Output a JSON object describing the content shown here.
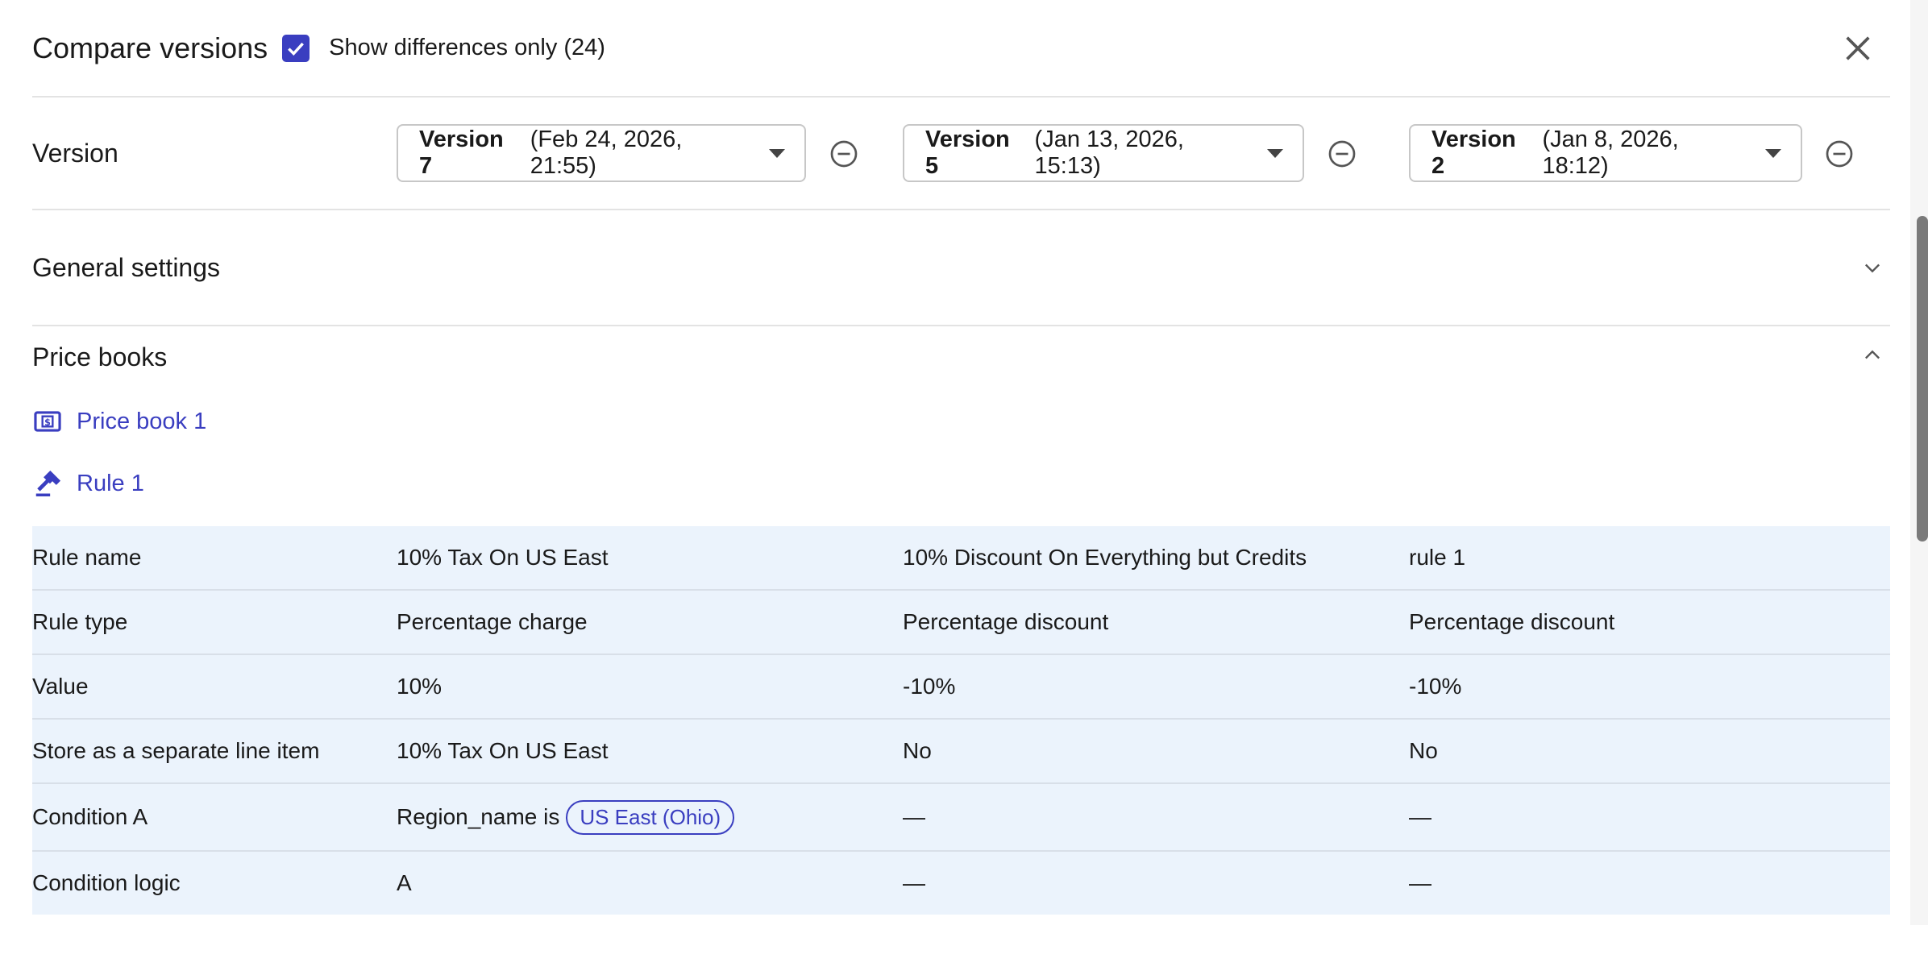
{
  "header": {
    "title": "Compare versions",
    "show_diff_label": "Show differences only (24)",
    "show_diff_checked": true
  },
  "version_row": {
    "label": "Version",
    "versions": [
      {
        "name": "Version 7",
        "date": "(Feb 24, 2026, 21:55)"
      },
      {
        "name": "Version 5",
        "date": "(Jan 13, 2026, 15:13)"
      },
      {
        "name": "Version 2",
        "date": "(Jan 8, 2026, 18:12)"
      }
    ]
  },
  "sections": {
    "general": "General settings",
    "price_books": "Price books"
  },
  "links": {
    "price_book": "Price book 1",
    "rule": "Rule 1"
  },
  "rows": [
    {
      "label": "Rule name",
      "v1": "10% Tax On US East",
      "v2": "10% Discount On Everything but Credits",
      "v3": "rule 1"
    },
    {
      "label": "Rule type",
      "v1": "Percentage charge",
      "v2": "Percentage discount",
      "v3": "Percentage discount"
    },
    {
      "label": "Value",
      "v1": "10%",
      "v2": "-10%",
      "v3": "-10%"
    },
    {
      "label": "Store as a separate line item",
      "v1": "10% Tax On US East",
      "v2": "No",
      "v3": "No"
    },
    {
      "label": "Condition A",
      "v1": "Region_name is",
      "v1_chip": "US East (Ohio)",
      "v2": "—",
      "v3": "—"
    },
    {
      "label": "Condition logic",
      "v1": "A",
      "v2": "—",
      "v3": "—"
    }
  ],
  "colors": {
    "accent": "#3a3ec0",
    "row_bg": "#ebf3fc"
  }
}
